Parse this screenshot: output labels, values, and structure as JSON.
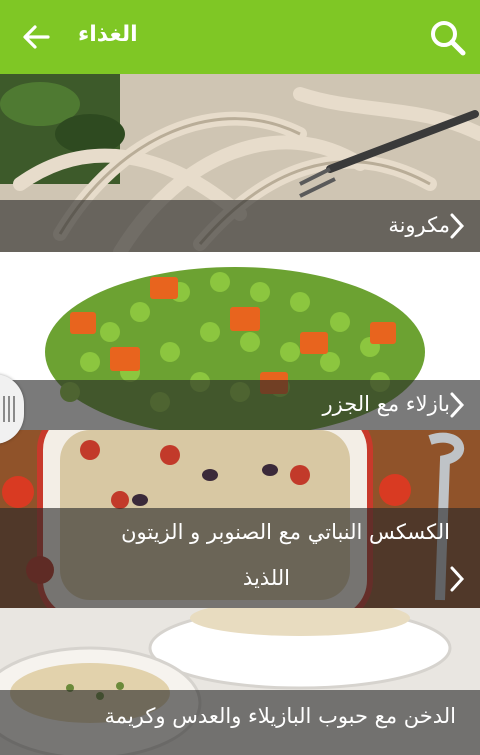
{
  "appbar": {
    "title": "الغذاء",
    "back_icon": "arrow-back-icon",
    "search_icon": "search-icon",
    "background": "#7fc725"
  },
  "recipes": [
    {
      "title": "مكرونة"
    },
    {
      "title": "بازلاء مع الجزر"
    },
    {
      "title": "الكسكس النباتي مع الصنوبر و الزيتون",
      "title_line2": "اللذيذ"
    },
    {
      "title": "الدخن مع حبوب البازيلاء والعدس وكريمة"
    }
  ],
  "drawer_handle_icon": "drawer-handle-icon",
  "chevron_icon": "chevron-right-icon"
}
